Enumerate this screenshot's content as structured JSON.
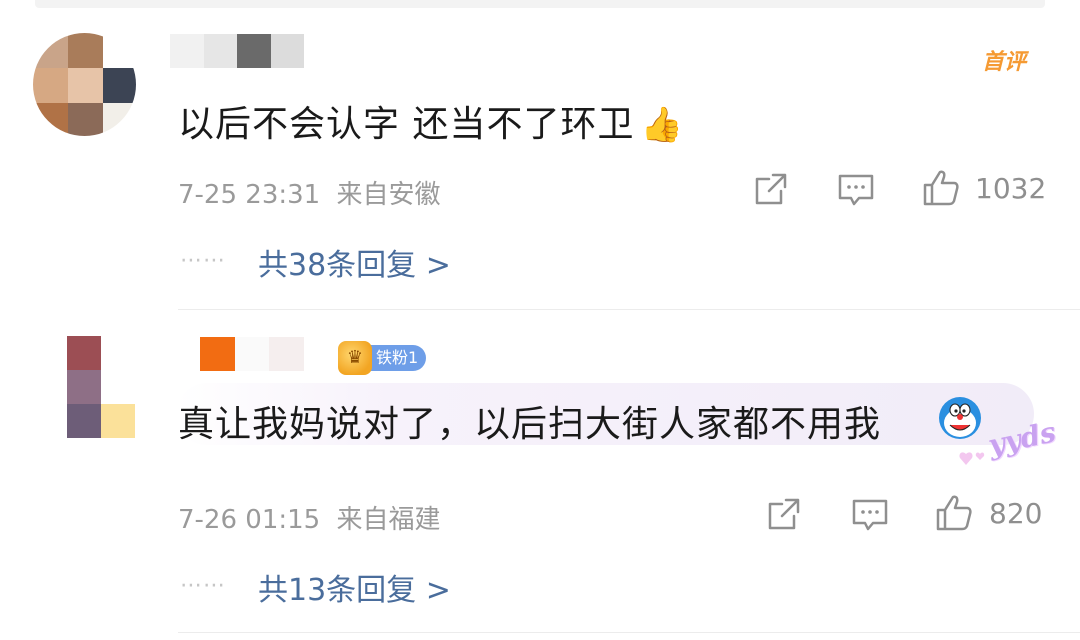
{
  "comments": [
    {
      "text": "以后不会认字 还当不了环卫",
      "emoji": "👍",
      "badge_first": "首评",
      "time": "7-25 23:31",
      "location": "来自安徽",
      "likes": "1032",
      "dots": "⋯⋯",
      "replies_link": "共38条回复 >"
    },
    {
      "text": "真让我妈说对了，以后扫大街人家都不用我",
      "fan_badge": "铁粉1",
      "sticker": "yyds",
      "time": "7-26 01:15",
      "location": "来自福建",
      "likes": "820",
      "dots": "⋯⋯",
      "replies_link": "共13条回复 >"
    }
  ],
  "icons": {
    "repost": "share-edit-icon",
    "comment": "comment-icon",
    "like": "thumbs-up-icon"
  },
  "colors": {
    "link": "#4a6d9c",
    "meta": "#9a9a9a",
    "first_badge": "#f59a33",
    "fan_badge": "#6e9ee8"
  }
}
